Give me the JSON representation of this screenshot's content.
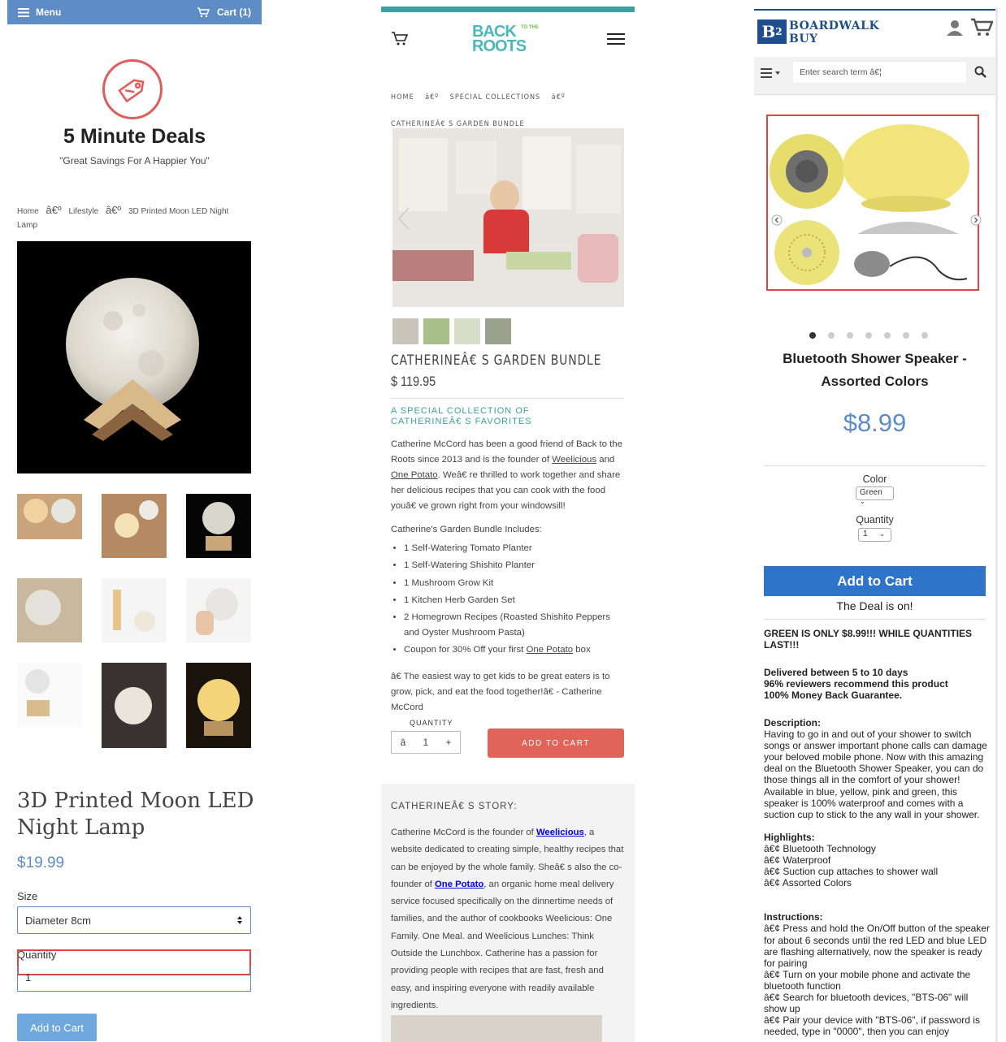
{
  "p1": {
    "menu_label": "Menu",
    "cart_label": "Cart (1)",
    "store_name": "5 Minute Deals",
    "tagline": "\"Great Savings For A Happier You\"",
    "breadcrumb": {
      "home": "Home",
      "sep": "â€º",
      "category": "Lifestyle",
      "current": "3D Printed Moon LED Night Lamp"
    },
    "product_title": "3D Printed Moon LED Night Lamp",
    "price": "$19.99",
    "size_label": "Size",
    "size_value": "Diameter 8cm",
    "quantity_label": "Quantity",
    "quantity_value": "1",
    "add_to_cart": "Add to Cart",
    "colors": {
      "bar": "#5e8cc4",
      "logo": "#e05b5b",
      "button": "#6fa8dc"
    }
  },
  "p2": {
    "breadcrumb": {
      "home": "HOME",
      "sep": "â€º",
      "category": "SPECIAL COLLECTIONS",
      "current": "CATHERINEÂ€ S GARDEN BUNDLE"
    },
    "logo_line1": "BACK",
    "logo_tothe": "TO THE",
    "logo_line2": "ROOTS",
    "product_title": "CATHERINEÂ€ S GARDEN BUNDLE",
    "price": "$ 119.95",
    "subtitle": "A SPECIAL COLLECTION OF CATHERINEÂ€ S FAVORITES",
    "intro": {
      "t1": "Catherine McCord has been a good friend of Back to the Roots since 2013 and is the founder of ",
      "link1": "Weelicious",
      "t2": " and ",
      "link2": "One Potato",
      "t3": ". Weâ€ re thrilled to work together and share her delicious recipes that you can cook with the food youâ€ ve grown right from your windowsill!"
    },
    "includes_heading": "Catherine's Garden Bundle Includes:",
    "includes": [
      "1 Self-Watering Tomato Planter",
      "1 Self-Watering Shishito Planter",
      "1 Mushroom Grow Kit",
      "1 Kitchen Herb Garden Set",
      "2 Homegrown Recipes (Roasted Shishito Peppers and Oyster Mushroom Pasta)"
    ],
    "coupon": {
      "t1": "Coupon for 30% Off your first ",
      "link": "One Potato",
      "t2": " box"
    },
    "quote": "â€ The easiest way to get kids to be great eaters is to grow, pick, and eat the food together!â€ - Catherine McCord",
    "quantity_label": "QUANTITY",
    "qty_minus": "â",
    "qty_value": "1",
    "qty_plus": "+",
    "add_to_cart": "ADD TO CART",
    "story_heading": "CATHERINEÂ€ S STORY:",
    "story": {
      "t1": "Catherine McCord is the founder of ",
      "link1": "Weelicious",
      "t2": ", a website dedicated to creating simple, healthy recipes that can be enjoyed by the whole family. Sheâ€ s also the co-founder of ",
      "link2": "One Potato",
      "t3": ", an organic home meal delivery service focused specifically on the dinnertime needs of families, and the author of cookbooks Weelicious: One Family. One Meal. and Weelicious Lunches: Think Outside the Lunchbox. Catherine has a passion for providing people with recipes that are fast, fresh and easy, and inspiring everyone with readily available ingredients."
    },
    "colors": {
      "teal": "#3d9f9f",
      "button": "#e0645a",
      "link": "#0000ee"
    }
  },
  "p3": {
    "brand_line1": "BOARDWALK",
    "brand_line2": "BUY",
    "logo_text": "B",
    "logo_sup": "2",
    "search_placeholder": "Enter search term â€¦",
    "product_title": "Bluetooth Shower Speaker - Assorted Colors",
    "price": "$8.99",
    "color_label": "Color",
    "color_value": "Green",
    "quantity_label": "Quantity",
    "quantity_value": "1",
    "add_to_cart": "Add to Cart",
    "deal_text": "The Deal is on!",
    "promo": "GREEN IS ONLY $8.99!!! WHILE QUANTITIES LAST!!!",
    "delivery": "Delivered between 5 to 10 days",
    "reviewers": "96% reviewers recommend this product",
    "guarantee": "100% Money Back Guarantee.",
    "description_heading": "Description:",
    "description": "Having to go in and out of your shower to switch songs or answer important phone calls can damage your beloved mobile phone. Now with this amazing deal on the Bluetooth Shower Speaker, you can do those things all in the comfort of your shower! Available in blue, yellow, pink and green, this speaker is 100% waterproof and comes with a suction cup to stick to the any wall in your shower.",
    "highlights_heading": "Highlights:",
    "highlights": [
      "â€¢ Bluetooth Technology",
      "â€¢ Waterproof",
      "â€¢ Suction cup attaches to shower wall",
      "â€¢ Assorted Colors"
    ],
    "instructions_heading": "Instructions:",
    "instructions": [
      "â€¢ Press and hold the On/Off button of the speaker for about 6 seconds until the red LED and blue LED are flashing alternatively, now the speaker is ready for pairing",
      "â€¢ Turn on your mobile phone and activate the bluetooth function",
      "â€¢ Search for bluetooth devices, \"BTS-06\" will show up",
      "â€¢ Pair your device with \"BTS-06\", if password is needed, type in \"0000\", then you can enjoy"
    ],
    "colors": {
      "brand": "#1f4e8c",
      "button": "#2e74c9",
      "price": "#5e8cc4"
    }
  }
}
